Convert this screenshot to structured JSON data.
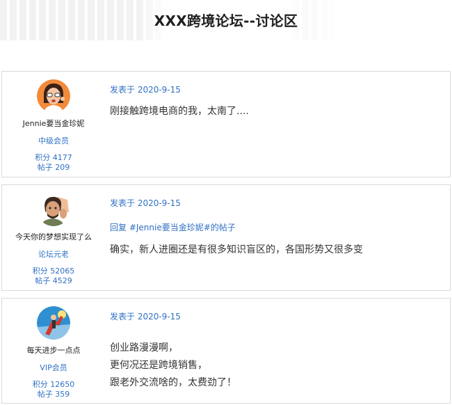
{
  "header": {
    "title": "XXX跨境论坛--讨论区"
  },
  "posts": [
    {
      "author": {
        "name": "Jennie要当金珍妮",
        "level": "中级会员",
        "points": "积分 4177",
        "posts": "帖子 209"
      },
      "date": "发表于 2020-9-15",
      "reply_to": "",
      "lines": [
        "刚接触跨境电商的我，太南了...."
      ]
    },
    {
      "author": {
        "name": "今天你的梦想实现了么",
        "level": "论坛元老",
        "points": "积分 52065",
        "posts": "帖子 4529"
      },
      "date": "发表于 2020-9-15",
      "reply_to": "回复 #Jennie要当金珍妮#的帖子",
      "lines": [
        "确实，新人进圈还是有很多知识盲区的，各国形势又很多变"
      ]
    },
    {
      "author": {
        "name": "每天进步一点点",
        "level": "VIP会员",
        "points": "积分 12650",
        "posts": "帖子 359"
      },
      "date": "发表于 2020-9-15",
      "reply_to": "",
      "lines": [
        "创业路漫漫啊，",
        "更何况还是跨境销售，",
        "跟老外交流啥的，太费劲了！"
      ]
    }
  ]
}
